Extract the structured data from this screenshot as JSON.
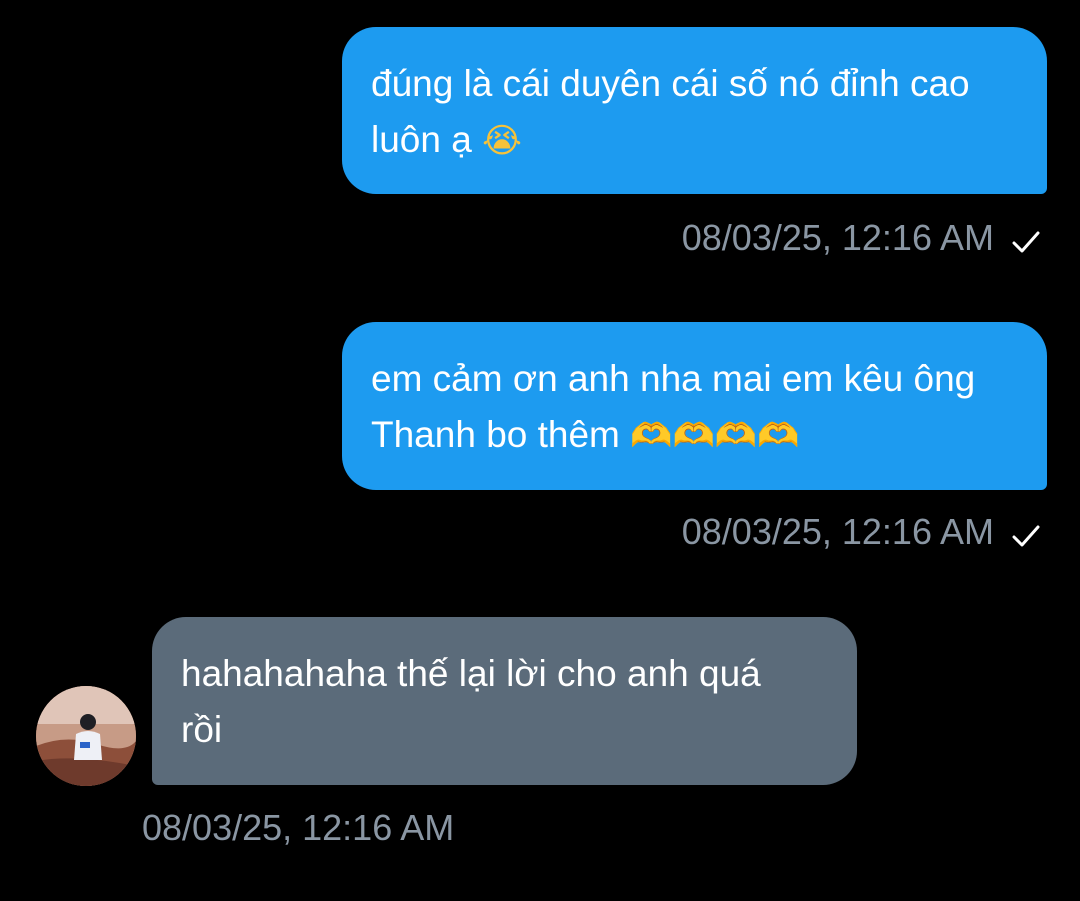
{
  "messages": [
    {
      "direction": "sent",
      "lines": [
        "đúng là cái duyên cái số nó đỉnh cao",
        "luôn ạ"
      ],
      "emoji": "😭",
      "timestamp": "08/03/25, 12:16 AM",
      "status_icon": "check-icon"
    },
    {
      "direction": "sent",
      "lines": [
        "em cảm ơn anh nha mai em kêu ông",
        "Thanh bo thêm"
      ],
      "emoji": "🫶🫶🫶🫶",
      "timestamp": "08/03/25, 12:16 AM",
      "status_icon": "check-icon"
    },
    {
      "direction": "received",
      "lines": [
        "hahahahaha thế lại lời cho anh quá",
        "rồi"
      ],
      "timestamp": "08/03/25, 12:16 AM",
      "avatar_icon": "avatar"
    }
  ],
  "colors": {
    "background": "#000000",
    "sent_bubble": "#1d9bf0",
    "received_bubble": "#5b6b7a",
    "timestamp": "#8a96a3",
    "text": "#ffffff"
  }
}
